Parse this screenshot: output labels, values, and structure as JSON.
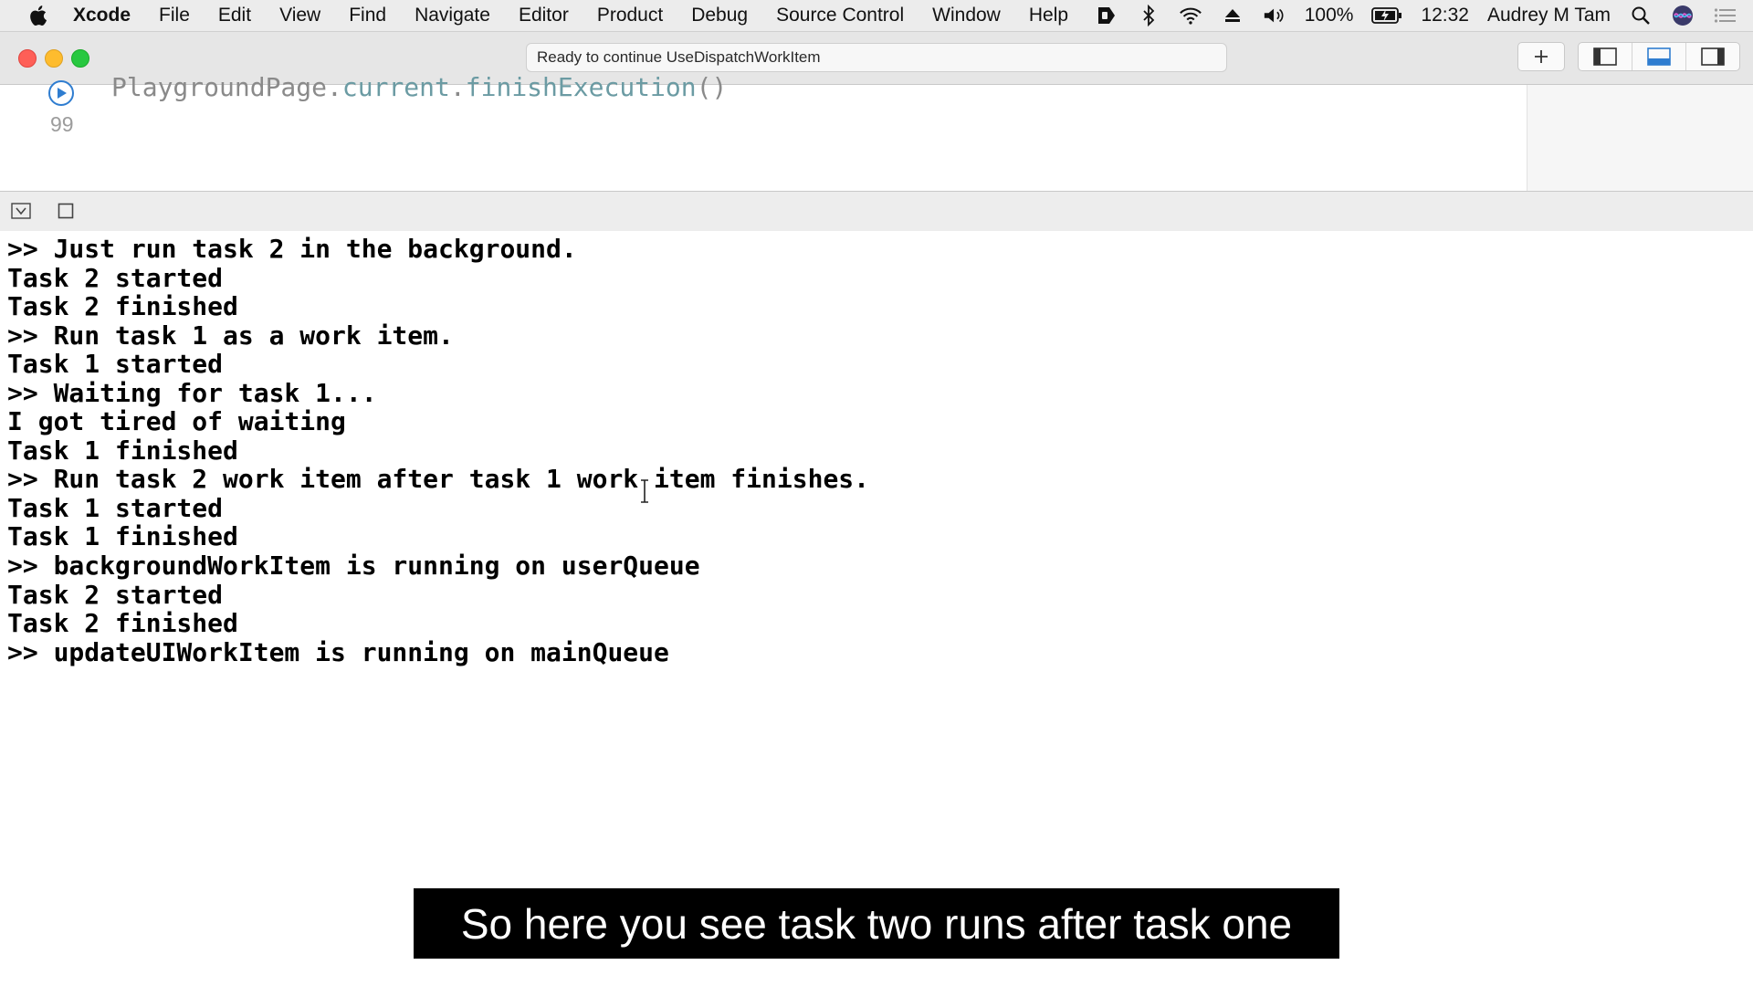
{
  "menubar": {
    "app": "Xcode",
    "items": [
      "File",
      "Edit",
      "View",
      "Find",
      "Navigate",
      "Editor",
      "Product",
      "Debug",
      "Source Control",
      "Window",
      "Help"
    ],
    "battery": "100%",
    "clock": "12:32",
    "user": "Audrey M Tam",
    "status_icons": [
      "screen-record-icon",
      "bluetooth-icon",
      "wifi-icon",
      "eject-icon",
      "volume-icon",
      "battery-icon",
      "search-icon",
      "siri-icon",
      "notification-center-icon"
    ]
  },
  "toolbar": {
    "activity_text": "Ready to continue UseDispatchWorkItem",
    "add_icon": "plus-icon",
    "segments": [
      "navigator-toggle-icon",
      "debug-area-toggle-icon",
      "inspector-toggle-icon"
    ]
  },
  "editor": {
    "code_prefix": "PlaygroundPage.",
    "code_ident1": "current",
    "code_dot": ".",
    "code_ident2": "finishExecution",
    "code_suffix": "()",
    "line_number": "99"
  },
  "console": {
    "lines": [
      ">> Just run task 2 in the background.",
      "Task 2 started",
      "Task 2 finished",
      ">> Run task 1 as a work item.",
      "Task 1 started",
      ">> Waiting for task 1...",
      "I got tired of waiting",
      "Task 1 finished",
      ">> Run task 2 work item after task 1 work item finishes.",
      "Task 1 started",
      "Task 1 finished",
      ">> backgroundWorkItem is running on userQueue",
      "Task 2 started",
      "Task 2 finished",
      ">> updateUIWorkItem is running on mainQueue"
    ]
  },
  "caption": "So here you see task two runs after task one",
  "colors": {
    "close": "#fe5f57",
    "minimize": "#febc2e",
    "zoom": "#28c840",
    "accent": "#2f7dd0"
  }
}
